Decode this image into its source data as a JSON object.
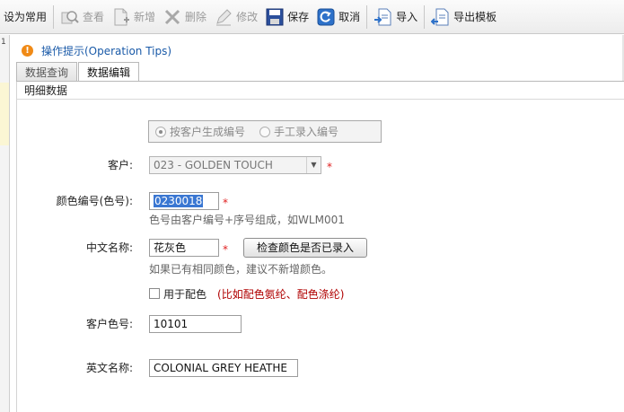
{
  "toolbar": {
    "items": [
      {
        "label": "设为常用",
        "icon": "none",
        "disabled": false
      },
      {
        "label": "查看",
        "icon": "view-icon",
        "disabled": true
      },
      {
        "label": "新增",
        "icon": "add-icon",
        "disabled": true
      },
      {
        "label": "删除",
        "icon": "delete-icon",
        "disabled": true
      },
      {
        "label": "修改",
        "icon": "edit-icon",
        "disabled": true
      },
      {
        "label": "保存",
        "icon": "save-icon",
        "disabled": false
      },
      {
        "label": "取消",
        "icon": "cancel-icon",
        "disabled": false
      },
      {
        "label": "导入",
        "icon": "import-icon",
        "disabled": false
      },
      {
        "label": "导出模板",
        "icon": "export-template-icon",
        "disabled": false
      }
    ]
  },
  "left_strip": {
    "number": "1"
  },
  "tip": {
    "icon": "warning-icon",
    "text": "操作提示(Operation Tips)"
  },
  "tabs": [
    {
      "label": "数据查询",
      "active": false
    },
    {
      "label": "数据编辑",
      "active": true
    }
  ],
  "section": {
    "title": "明细数据"
  },
  "form": {
    "radio_options": [
      {
        "label": "按客户生成编号",
        "checked": true
      },
      {
        "label": "手工录入编号",
        "checked": false
      }
    ],
    "customer": {
      "label": "客户:",
      "value": "023 - GOLDEN TOUCH",
      "required": "*"
    },
    "color_code": {
      "label": "颜色编号(色号):",
      "value": "0230018",
      "required": "*",
      "hint": "色号由客户编号+序号组成，如WLM001"
    },
    "chinese_name": {
      "label": "中文名称:",
      "value": "花灰色",
      "required": "*",
      "button": "检查颜色是否已录入",
      "hint": "如果已有相同颜色，建议不新增颜色。"
    },
    "use_for_matching": {
      "label": "用于配色",
      "note": "(比如配色氨纶、配色涤纶)",
      "checked": false
    },
    "customer_color_no": {
      "label": "客户色号:",
      "value": "10101"
    },
    "english_name": {
      "label": "英文名称:",
      "value": "COLONIAL GREY HEATHE"
    }
  },
  "colors": {
    "accent": "#1a5aa8",
    "required": "#e02020",
    "note": "#b00000",
    "selection": "#3a77d2"
  }
}
